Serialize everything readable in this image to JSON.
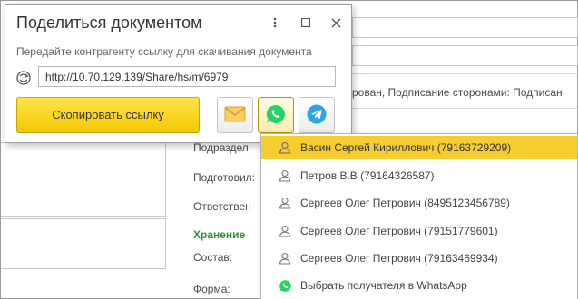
{
  "dialog": {
    "title": "Поделиться документом",
    "subtitle": "Передайте контрагенту ссылку для скачивания документа",
    "link_value": "http://10.70.129.139/Share/hs/m/6979",
    "copy_label": "Скопировать ссылку",
    "buttons": [
      {
        "name": "email",
        "icon": "envelope-icon"
      },
      {
        "name": "whatsapp",
        "icon": "whatsapp-icon"
      },
      {
        "name": "telegram",
        "icon": "telegram-icon"
      }
    ]
  },
  "background": {
    "status_text": "рован, Подписание сторонами: Подписан",
    "labels": {
      "department": "Подраздел",
      "prepared": "Подготовил:",
      "responsible": "Ответствен",
      "storage_heading": "Хранение",
      "composition": "Состав:",
      "form": "Форма:"
    }
  },
  "recipients": {
    "items": [
      {
        "label": "Васин Сергей Кириллович (79163729209)",
        "icon": "person-icon",
        "selected": true
      },
      {
        "label": "Петров В.В (79164326587)",
        "icon": "person-icon",
        "selected": false
      },
      {
        "label": "Сергеев Олег Петрович (8495123456789)",
        "icon": "person-icon",
        "selected": false
      },
      {
        "label": "Сергеев Олег Петрович (79151779601)",
        "icon": "person-icon",
        "selected": false
      },
      {
        "label": "Сергеев Олег Петрович (79163469934)",
        "icon": "person-icon",
        "selected": false
      },
      {
        "label": "Выбрать получателя в WhatsApp",
        "icon": "whatsapp-icon",
        "selected": false
      }
    ]
  },
  "colors": {
    "accent_yellow": "#f5cd2f",
    "whatsapp_green": "#25d366",
    "telegram_blue": "#2ca5e0",
    "heading_green": "#2f8f3a"
  }
}
